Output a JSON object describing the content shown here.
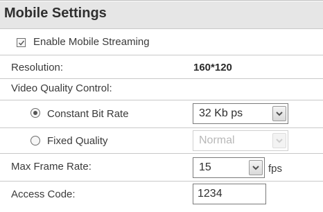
{
  "section": {
    "title": "Mobile Settings"
  },
  "mobile_streaming": {
    "label": "Enable Mobile Streaming",
    "checked": true
  },
  "resolution": {
    "label": "Resolution:",
    "value": "160*120"
  },
  "video_quality": {
    "label": "Video Quality Control:",
    "constant_bit_rate": {
      "label": "Constant Bit Rate",
      "selected": true,
      "value": "32 Kb ps"
    },
    "fixed_quality": {
      "label": "Fixed Quality",
      "selected": false,
      "value": "Normal",
      "disabled": true
    }
  },
  "max_frame_rate": {
    "label": "Max Frame Rate:",
    "value": "15",
    "unit": "fps"
  },
  "access_code": {
    "label": "Access Code:",
    "value": "1234"
  },
  "icons": {
    "checkbox": "check-icon",
    "dropdown": "chevron-down-icon"
  }
}
